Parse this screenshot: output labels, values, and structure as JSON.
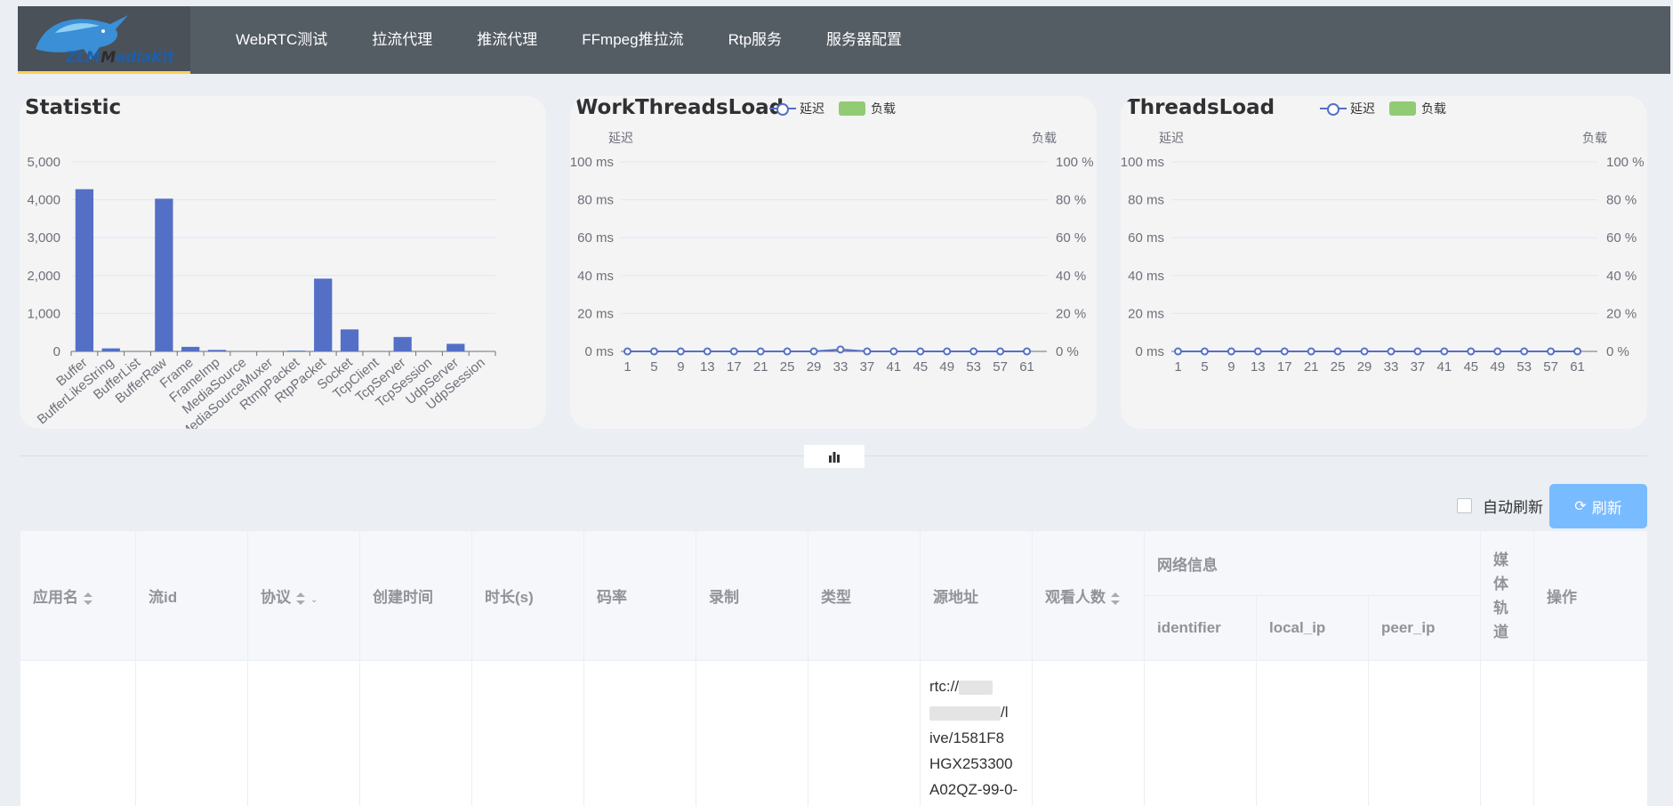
{
  "header": {
    "logo_text_a": "ZLM",
    "logo_text_b": "ediaKit",
    "nav": [
      "WebRTC测试",
      "拉流代理",
      "推流代理",
      "FFmpeg推拉流",
      "Rtp服务",
      "服务器配置"
    ]
  },
  "statistic": {
    "title": "Statistic",
    "chart_data": {
      "type": "bar",
      "categories": [
        "Buffer",
        "BufferLikeString",
        "BufferList",
        "BufferRaw",
        "Frame",
        "FrameImp",
        "MediaSource",
        "MediaSourceMuxer",
        "RtmpPacket",
        "RtpPacket",
        "Socket",
        "TcpClient",
        "TcpServer",
        "TcpSession",
        "UdpServer",
        "UdpSession"
      ],
      "values": [
        4280,
        80,
        0,
        4030,
        120,
        40,
        0,
        0,
        20,
        1920,
        580,
        0,
        380,
        0,
        200,
        0
      ],
      "y_ticks": [
        "0",
        "1,000",
        "2,000",
        "3,000",
        "4,000",
        "5,000"
      ],
      "ylim": [
        0,
        5000
      ],
      "color": "#5470c6"
    }
  },
  "work_threads": {
    "title": "WorkThreadsLoad",
    "legend_delay": "延迟",
    "legend_load": "负载",
    "axis_left": "延迟",
    "axis_right": "负载",
    "chart_data": {
      "type": "line",
      "x": [
        1,
        5,
        9,
        13,
        17,
        21,
        25,
        29,
        33,
        37,
        41,
        45,
        49,
        53,
        57,
        61
      ],
      "x_ticks": [
        "1",
        "5",
        "9",
        "13",
        "17",
        "21",
        "25",
        "29",
        "33",
        "37",
        "41",
        "45",
        "49",
        "53",
        "57",
        "61"
      ],
      "y_left_ticks": [
        "0 ms",
        "20 ms",
        "40 ms",
        "60 ms",
        "80 ms",
        "100 ms"
      ],
      "y_right_ticks": [
        "0 %",
        "20 %",
        "40 %",
        "60 %",
        "80 %",
        "100 %"
      ],
      "ylim": [
        0,
        100
      ],
      "series": [
        {
          "name": "延迟",
          "values": [
            0,
            0,
            0,
            0,
            0,
            0,
            0,
            0,
            1,
            0,
            0,
            0,
            0,
            0,
            0,
            0
          ]
        }
      ]
    }
  },
  "threads": {
    "title": "ThreadsLoad",
    "legend_delay": "延迟",
    "legend_load": "负载",
    "axis_left": "延迟",
    "axis_right": "负载",
    "chart_data": {
      "type": "line",
      "x": [
        1,
        5,
        9,
        13,
        17,
        21,
        25,
        29,
        33,
        37,
        41,
        45,
        49,
        53,
        57,
        61
      ],
      "x_ticks": [
        "1",
        "5",
        "9",
        "13",
        "17",
        "21",
        "25",
        "29",
        "33",
        "37",
        "41",
        "45",
        "49",
        "53",
        "57",
        "61"
      ],
      "y_left_ticks": [
        "0 ms",
        "20 ms",
        "40 ms",
        "60 ms",
        "80 ms",
        "100 ms"
      ],
      "y_right_ticks": [
        "0 %",
        "20 %",
        "40 %",
        "60 %",
        "80 %",
        "100 %"
      ],
      "ylim": [
        0,
        100
      ],
      "series": [
        {
          "name": "延迟",
          "values": [
            0,
            0,
            0,
            0,
            0,
            0,
            0,
            0,
            0,
            0,
            0,
            0,
            0,
            0,
            0,
            0
          ]
        }
      ]
    }
  },
  "controls": {
    "auto_refresh": "自动刷新",
    "refresh": "刷新"
  },
  "table": {
    "cols": {
      "app": "应用名",
      "stream": "流id",
      "schema": "协议",
      "created": "创建时间",
      "duration": "时长(s)",
      "bitrate": "码率",
      "record": "录制",
      "type": "类型",
      "origin": "源地址",
      "viewers": "观看人数",
      "network": "网络信息",
      "identifier": "identifier",
      "local_ip": "local_ip",
      "peer_ip": "peer_ip",
      "tracks": "媒体轨道",
      "ops": "操作"
    },
    "row": {
      "origin_l1": "rtc://",
      "origin_l2": "/l",
      "origin_l3": "ive/1581F8",
      "origin_l4": "HGX253300",
      "origin_l5": "A02QZ-99-0-"
    }
  }
}
